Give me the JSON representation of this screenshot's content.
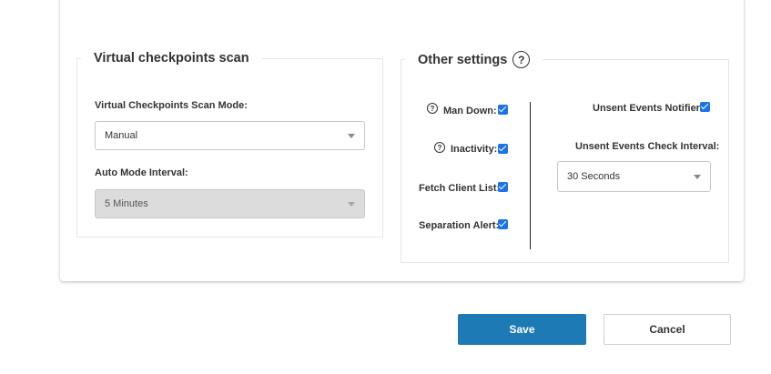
{
  "virtual_checkpoints": {
    "title": "Virtual checkpoints scan",
    "scan_mode_label": "Virtual Checkpoints Scan Mode:",
    "scan_mode_value": "Manual",
    "auto_interval_label": "Auto Mode Interval:",
    "auto_interval_value": "5 Minutes"
  },
  "other_settings": {
    "title": "Other settings",
    "help_glyph": "?",
    "man_down": {
      "label": "Man Down:",
      "checked": true
    },
    "inactivity": {
      "label": "Inactivity:",
      "checked": true
    },
    "fetch_client_list": {
      "label": "Fetch Client List:",
      "checked": true
    },
    "separation_alert": {
      "label": "Separation Alert:",
      "checked": true
    },
    "unsent_events_notifier": {
      "label": "Unsent Events Notifier:",
      "checked": true
    },
    "unsent_events_interval_label": "Unsent Events Check Interval:",
    "unsent_events_interval_value": "30 Seconds"
  },
  "actions": {
    "save_label": "Save",
    "cancel_label": "Cancel"
  },
  "colors": {
    "accent": "#1e7ab5",
    "checkbox": "#1a73e8",
    "disabled_bg": "#dcdcdc"
  }
}
